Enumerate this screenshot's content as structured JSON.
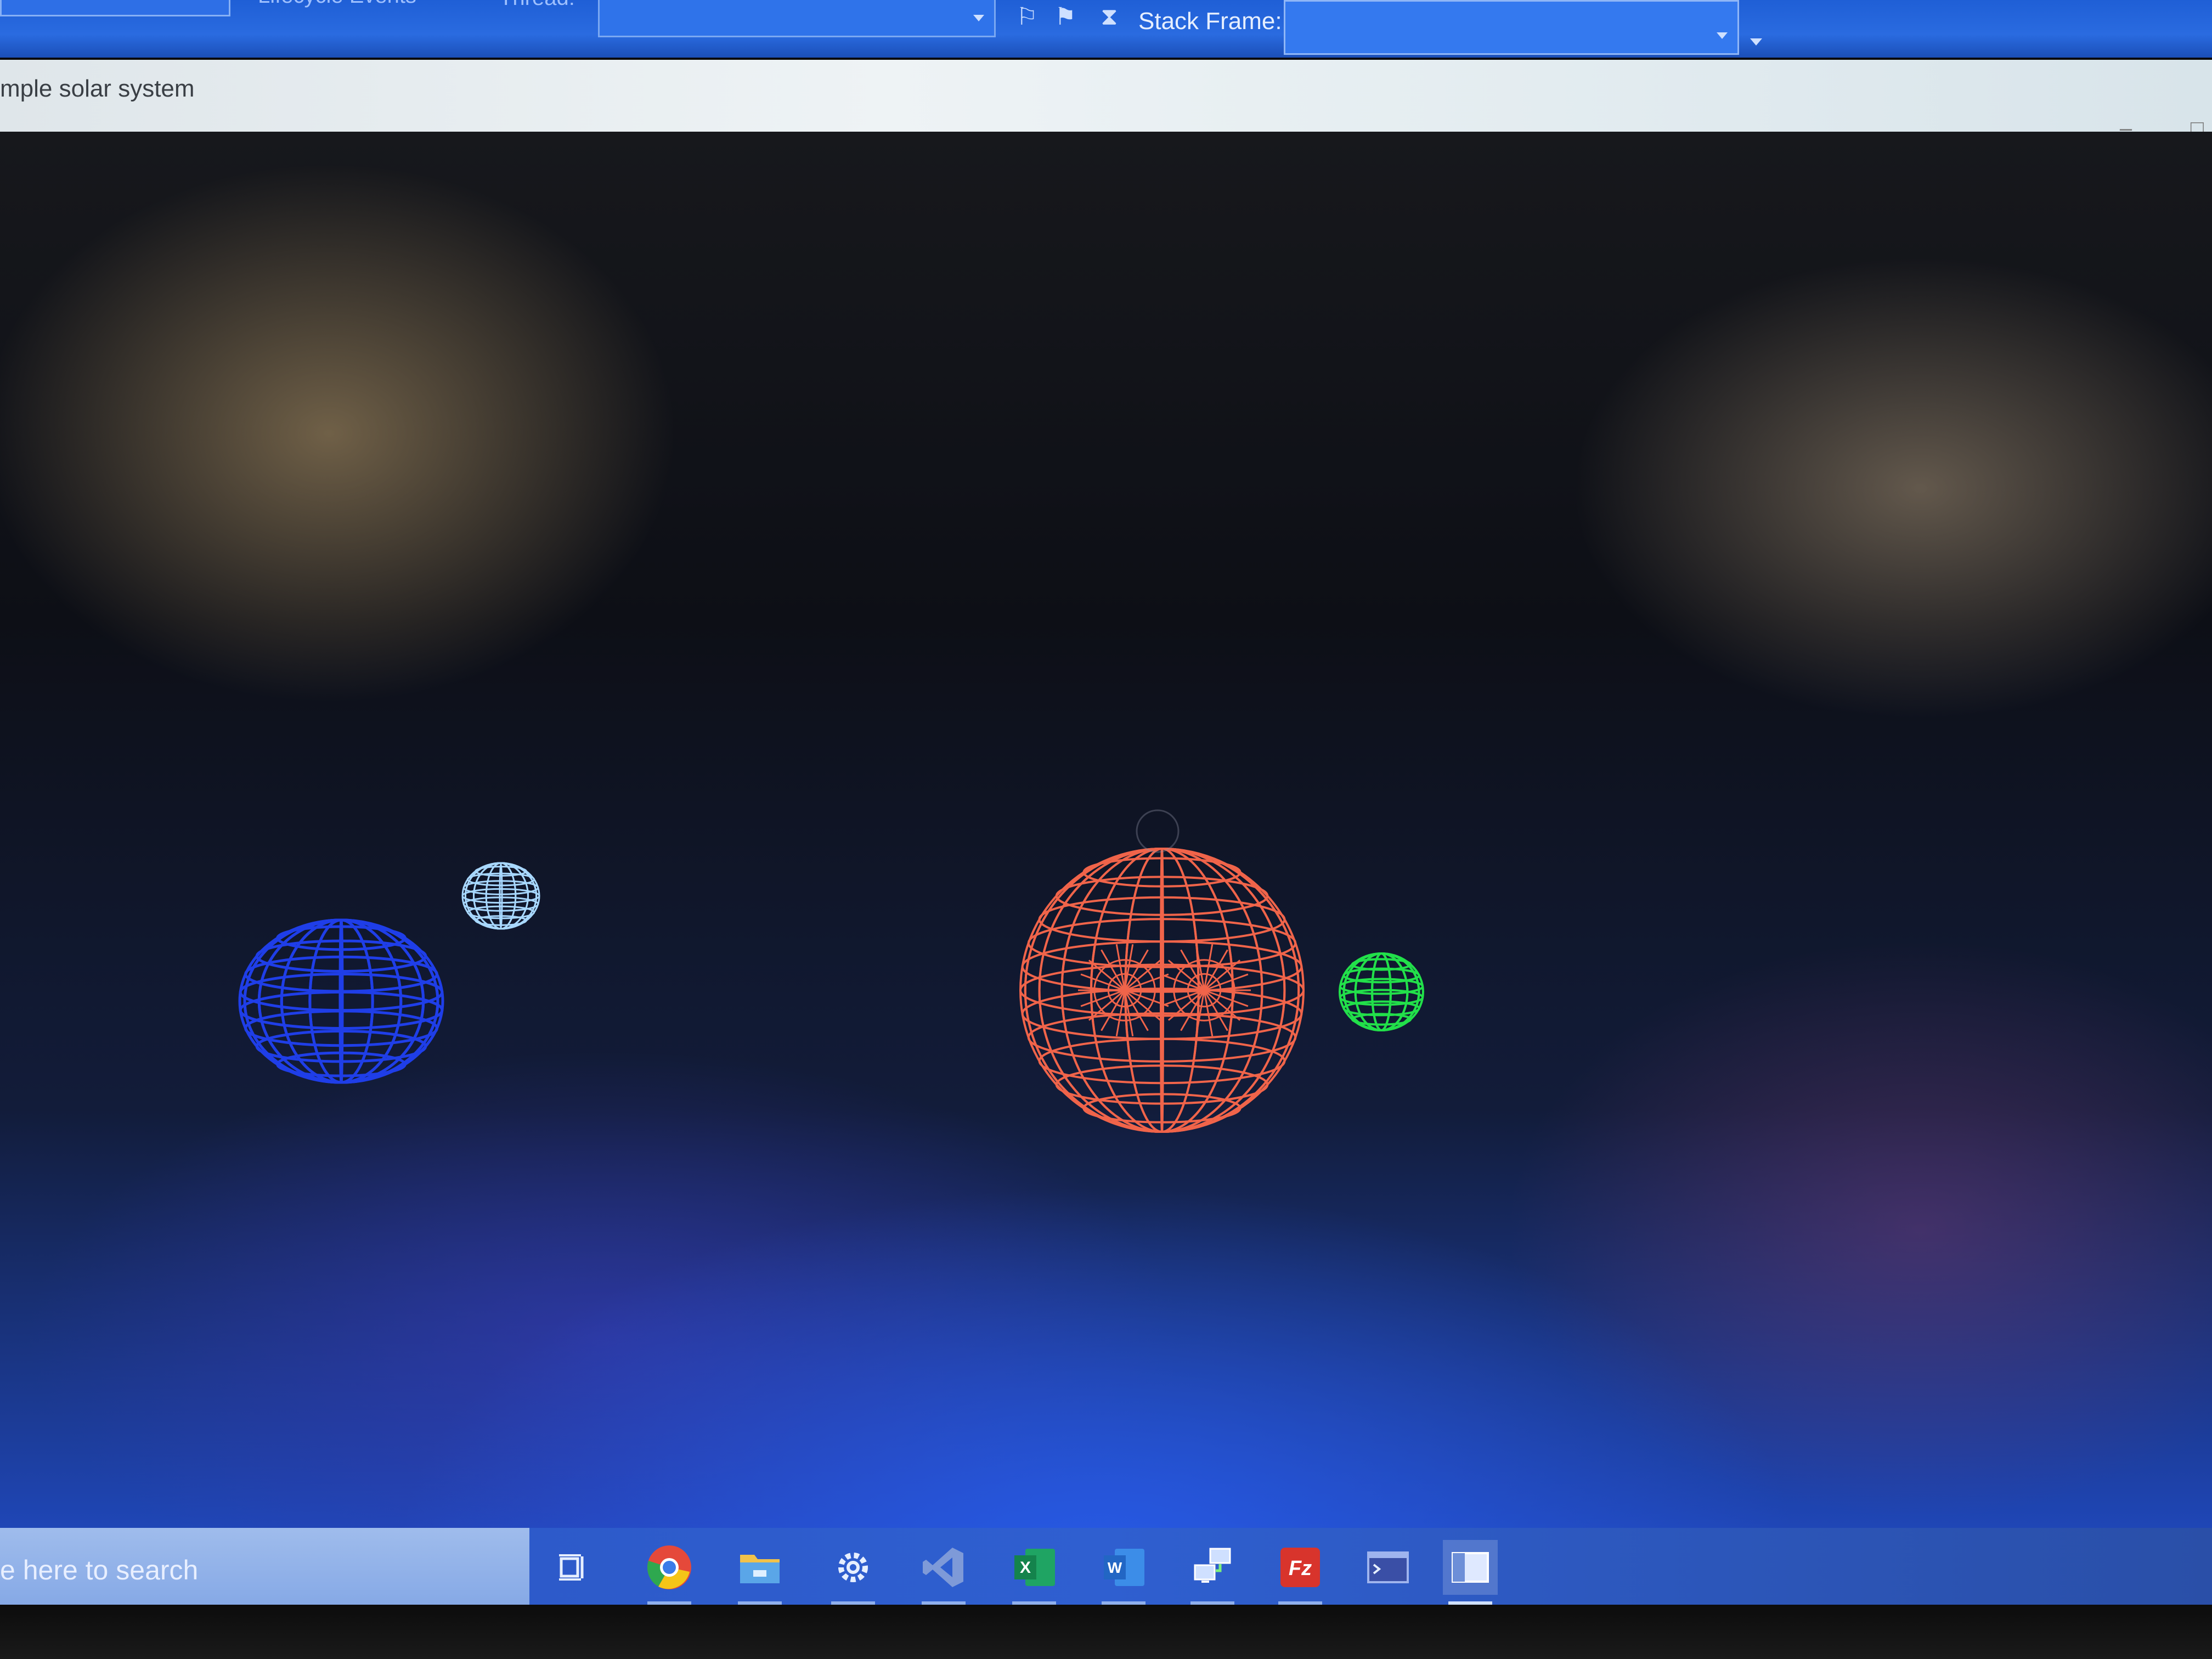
{
  "toolbar": {
    "events_label": "Lifecycle Events",
    "thread_label": "Thread:",
    "thread_value": "",
    "stack_frame_label": "Stack Frame:",
    "stack_frame_value": ""
  },
  "window": {
    "title": "mple solar system",
    "minimize_glyph": "–",
    "maximize_glyph": "□"
  },
  "scene": {
    "background": "dark blue gradient",
    "spheres": [
      {
        "name": "sun",
        "color": "#f0644a",
        "style": "wireframe"
      },
      {
        "name": "green-planet",
        "color": "#22e04a",
        "style": "wireframe"
      },
      {
        "name": "blue-planet",
        "color": "#1f3ee8",
        "style": "wireframe"
      },
      {
        "name": "light-blue-moon",
        "color": "#a8d8ff",
        "style": "wireframe"
      }
    ]
  },
  "taskbar": {
    "search_placeholder": "e here to search",
    "icons": [
      {
        "name": "task-view-icon"
      },
      {
        "name": "chrome-icon"
      },
      {
        "name": "file-explorer-icon"
      },
      {
        "name": "settings-icon"
      },
      {
        "name": "visual-studio-icon"
      },
      {
        "name": "excel-icon",
        "letter": "X"
      },
      {
        "name": "word-icon",
        "letter": "W"
      },
      {
        "name": "network-icon"
      },
      {
        "name": "filezilla-icon",
        "letter": "Fz"
      },
      {
        "name": "terminal-icon"
      },
      {
        "name": "app-window-icon"
      }
    ]
  }
}
